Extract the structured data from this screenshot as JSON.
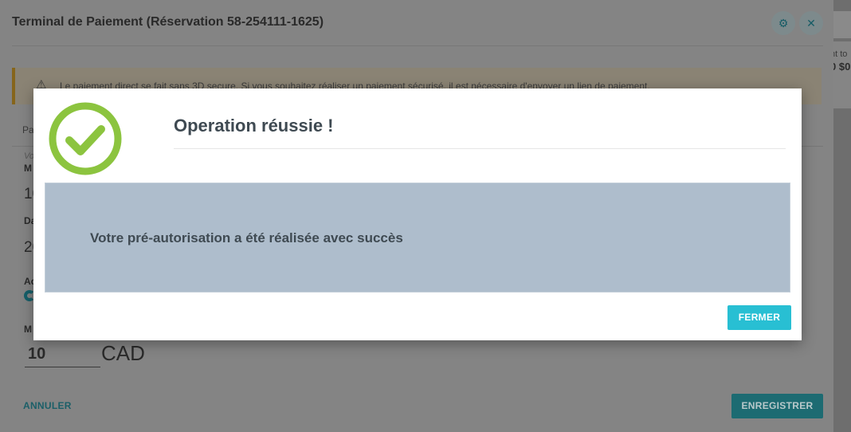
{
  "backdrop": {
    "partial_label": "nt to",
    "partial_amount": "0 $0"
  },
  "dialog": {
    "title": "Terminal de Paiement (Réservation 58-254111-1625)",
    "settings_icon": "gear-icon",
    "close_icon": "close-icon",
    "warning": {
      "icon": "warning-triangle-icon",
      "text": "Le paiement direct se fait sans 3D secure. Si vous souhaitez réaliser un paiement sécurisé, il est nécessaire d'envoyer un lien de paiement."
    },
    "tab_fragment": "Pa",
    "hint_fragment": "Vo",
    "field1_label_fragment": "M",
    "field1_value_fragment": "10",
    "field2_label_fragment": "Da",
    "field2_value_fragment": "20",
    "field3_label_fragment": "Ac",
    "field4_label_fragment": "M",
    "amount_value": "10",
    "currency": "CAD",
    "cancel_label": "ANNULER",
    "save_label": "ENREGISTRER"
  },
  "modal": {
    "icon": "check-circle-icon",
    "title": "Operation réussie !",
    "message": "Votre pré-autorisation a été réalisée avec succès",
    "close_label": "FERMER"
  },
  "colors": {
    "accent": "#28bfd3",
    "success": "#8cc43f",
    "modal_body": "#aebdcc"
  }
}
